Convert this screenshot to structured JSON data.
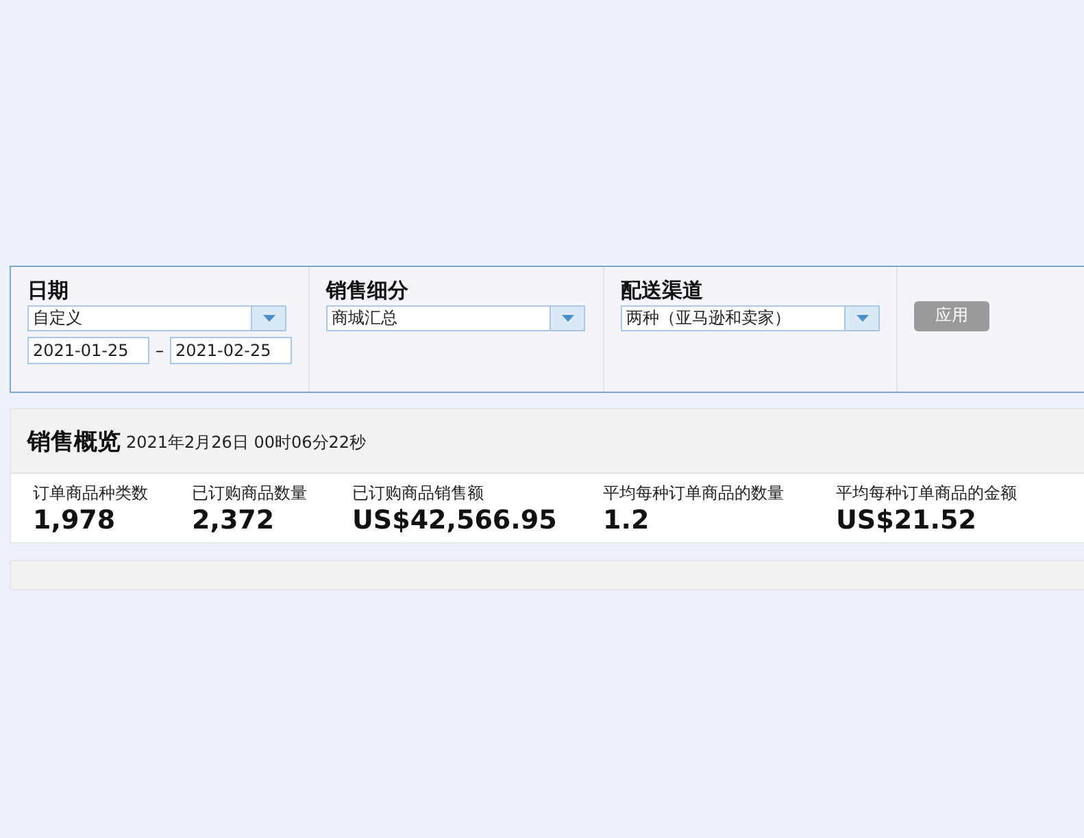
{
  "filters": [
    {
      "label": "日期",
      "dropdown": "自定义",
      "date_from": "2021-01-25",
      "date_separator": "–",
      "date_to": "2021-02-25"
    },
    {
      "label": "销售细分",
      "dropdown": "商城汇总"
    },
    {
      "label": "配送渠道",
      "dropdown": "两种（亚马逊和卖家）"
    }
  ],
  "apply_button": {
    "label": "应用",
    "disabled": true
  },
  "overview": {
    "title": "销售概览",
    "timestamp": "2021年2月26日 00时06分22秒",
    "metrics": [
      {
        "label": "订单商品种类数",
        "value": "1,978"
      },
      {
        "label": "已订购商品数量",
        "value": "2,372"
      },
      {
        "label": "已订购商品销售额",
        "value": "US$42,566.95"
      },
      {
        "label": "平均每种订单商品的数量",
        "value": "1.2"
      },
      {
        "label": "平均每种订单商品的金额",
        "value": "US$21.52"
      }
    ]
  }
}
